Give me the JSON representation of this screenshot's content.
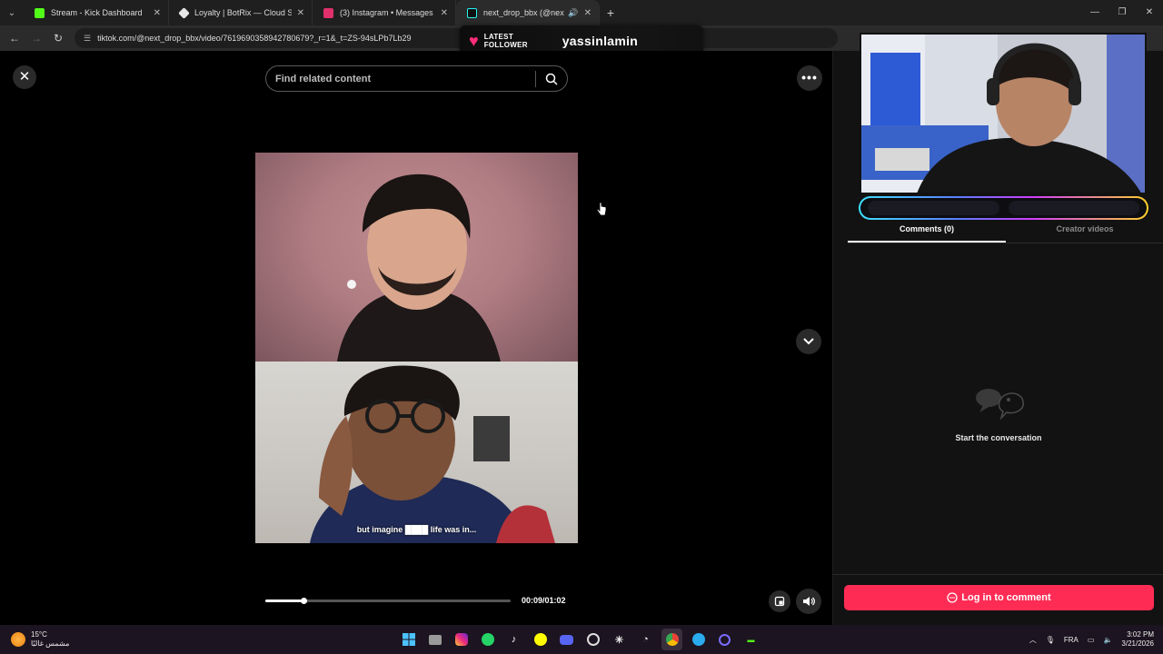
{
  "browser": {
    "tabs": [
      {
        "title": "Stream - Kick Dashboard",
        "favicon_color": "#53fc18",
        "active": false
      },
      {
        "title": "Loyalty | BotRix — Cloud Stream",
        "favicon_color": "#e6e6e6",
        "active": false
      },
      {
        "title": "(3) Instagram • Messages",
        "favicon_color": "#e1306c",
        "active": false
      },
      {
        "title": "next_drop_bbx (@next_drop",
        "favicon_color": "#25f4ee",
        "active": true
      }
    ],
    "url": "tiktok.com/@next_drop_bbx/video/7619690358942780679?_r=1&_t=ZS-94sLPb7Lb29"
  },
  "follower_alert": {
    "label": "LATEST FOLLOWER",
    "name": "yassinlamin"
  },
  "player": {
    "search_placeholder": "Find related content",
    "subtitle": "but imagine ████ life was in...",
    "timecode": "00:09/01:02",
    "progress": 0.155
  },
  "panel": {
    "tabs": [
      {
        "label": "Comments (0)",
        "active": true
      },
      {
        "label": "Creator videos",
        "active": false
      }
    ],
    "empty_text": "Start the conversation",
    "login_label": "Log in to comment"
  },
  "taskbar": {
    "temperature": "15°C",
    "weather": "مشمس غالبًا",
    "language": "FRA",
    "time": "3:02 PM",
    "date": "3/21/2026"
  },
  "colors": {
    "accent": "#fe2c55",
    "follower_heart": "#ff2d7a"
  }
}
